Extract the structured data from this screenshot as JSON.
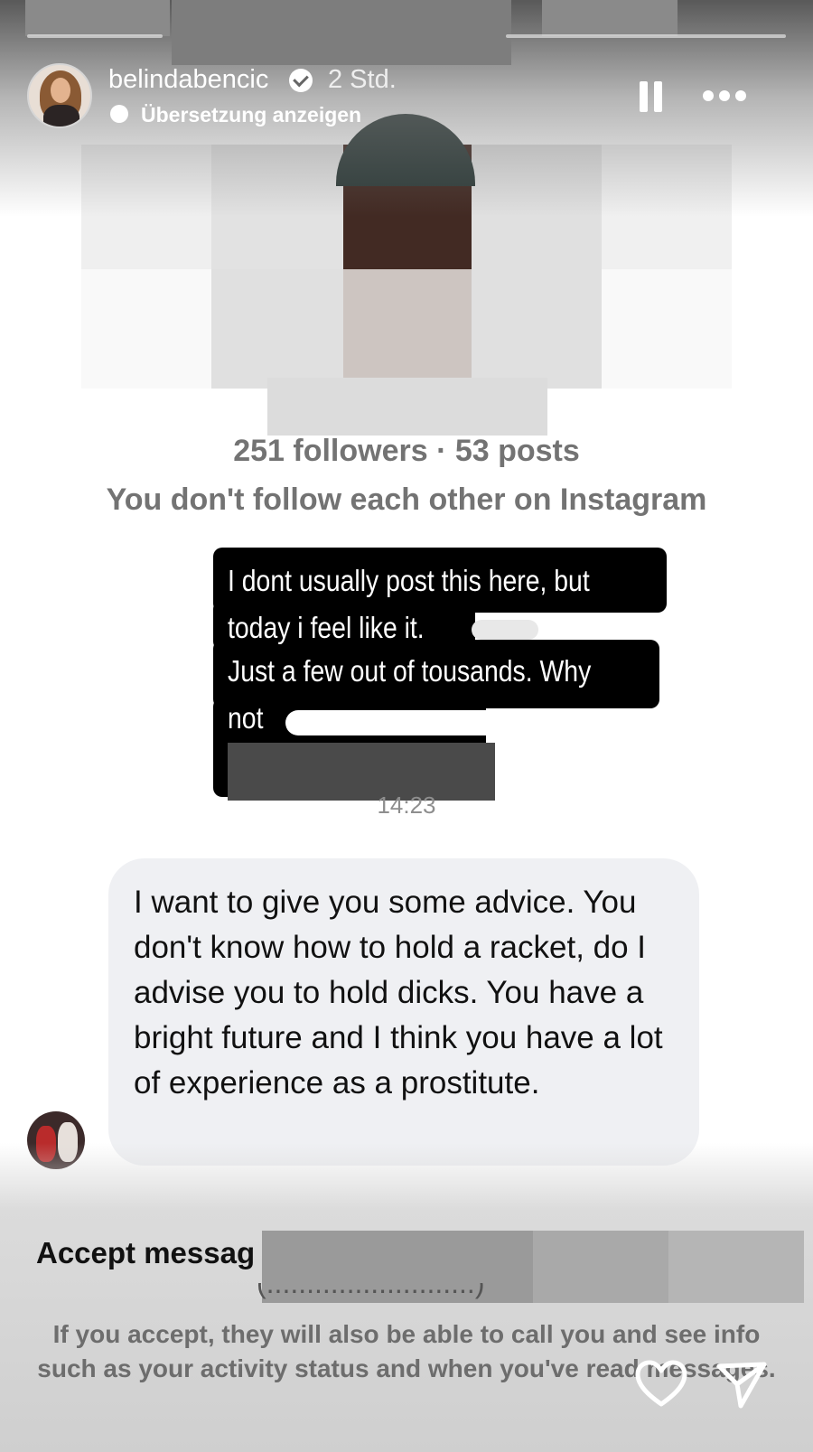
{
  "story": {
    "username": "belindabencic",
    "time": "2 Std.",
    "translate_label": "Übersetzung anzeigen",
    "pause_icon": "pause-icon",
    "more_icon": "more-icon"
  },
  "profile": {
    "followers_line": "251 followers · 53 posts",
    "relationship": "You don't follow each other on Instagram"
  },
  "overlay_text": {
    "line1": "I dont usually post this here, but",
    "line2": "today i feel like it.",
    "line3": "Just a few out of tousands. Why",
    "line4": "not"
  },
  "message": {
    "time": "14:23",
    "text": "I want to give you some advice. You don't know how to hold a racket, do I advise you to hold dicks. You have a bright future and I think you have a lot of experience as a prostitute."
  },
  "request": {
    "accept_prefix": "Accept messag",
    "info": "If you accept, they will also be able to call you and see info such as your activity status and when you've read messages."
  },
  "footer": {
    "like_icon": "heart-icon",
    "send_icon": "send-icon"
  }
}
